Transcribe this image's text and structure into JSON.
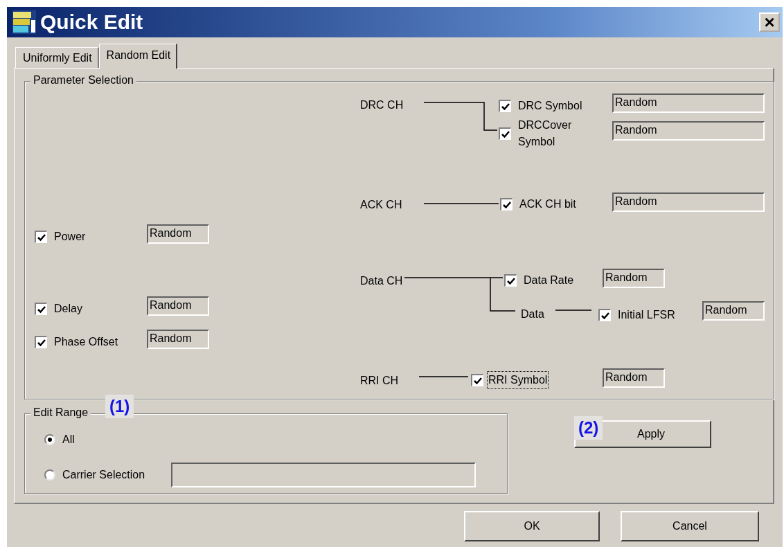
{
  "window": {
    "title": "Quick Edit",
    "close": "×"
  },
  "tabs": [
    {
      "label": "Uniformly Edit",
      "selected": false
    },
    {
      "label": "Random Edit",
      "selected": true
    }
  ],
  "parameter_selection": {
    "title": "Parameter Selection",
    "params": [
      {
        "label": "Power",
        "checked": true,
        "value": "Random"
      },
      {
        "label": "Delay",
        "checked": true,
        "value": "Random"
      },
      {
        "label": "Phase Offset",
        "checked": true,
        "value": "Random"
      }
    ],
    "channels": [
      {
        "name": "DRC CH"
      },
      {
        "name": "ACK CH"
      },
      {
        "name": "Data CH"
      },
      {
        "name": "RRI CH"
      }
    ],
    "data_node": "Data",
    "channel_params": [
      {
        "label": "DRC Symbol",
        "checked": true,
        "focused": false,
        "value": "Random"
      },
      {
        "label": "DRCCover Symbol",
        "checked": true,
        "focused": false,
        "value": "Random"
      },
      {
        "label": "ACK CH bit",
        "checked": true,
        "focused": false,
        "value": "Random"
      },
      {
        "label": "Data Rate",
        "checked": true,
        "focused": false,
        "value": "Random"
      },
      {
        "label": "Initial LFSR",
        "checked": true,
        "focused": false,
        "value": "Random"
      },
      {
        "label": "RRI Symbol",
        "checked": true,
        "focused": true,
        "value": "Random"
      }
    ]
  },
  "edit_range": {
    "title": "Edit Range",
    "options": [
      {
        "label": "All",
        "selected": true
      },
      {
        "label": "Carrier Selection",
        "selected": false
      }
    ]
  },
  "apply_button": "Apply",
  "annotations": [
    "(1)",
    "(2)"
  ],
  "buttons": [
    "OK",
    "Cancel"
  ]
}
